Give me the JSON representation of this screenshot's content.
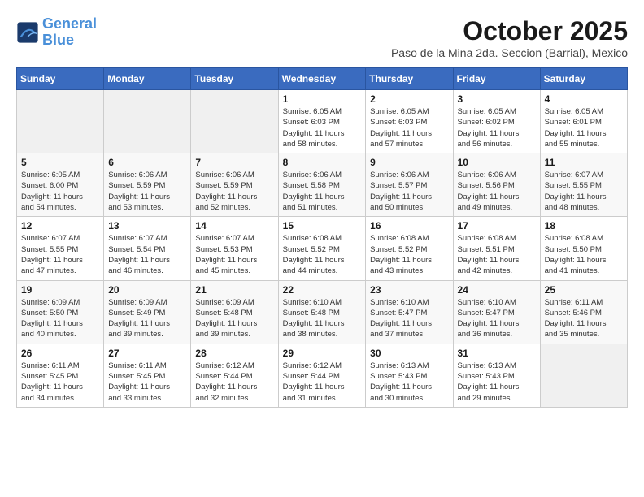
{
  "header": {
    "logo_line1": "General",
    "logo_line2": "Blue",
    "month": "October 2025",
    "location": "Paso de la Mina 2da. Seccion (Barrial), Mexico"
  },
  "days_of_week": [
    "Sunday",
    "Monday",
    "Tuesday",
    "Wednesday",
    "Thursday",
    "Friday",
    "Saturday"
  ],
  "weeks": [
    [
      {
        "num": "",
        "info": ""
      },
      {
        "num": "",
        "info": ""
      },
      {
        "num": "",
        "info": ""
      },
      {
        "num": "1",
        "info": "Sunrise: 6:05 AM\nSunset: 6:03 PM\nDaylight: 11 hours\nand 58 minutes."
      },
      {
        "num": "2",
        "info": "Sunrise: 6:05 AM\nSunset: 6:03 PM\nDaylight: 11 hours\nand 57 minutes."
      },
      {
        "num": "3",
        "info": "Sunrise: 6:05 AM\nSunset: 6:02 PM\nDaylight: 11 hours\nand 56 minutes."
      },
      {
        "num": "4",
        "info": "Sunrise: 6:05 AM\nSunset: 6:01 PM\nDaylight: 11 hours\nand 55 minutes."
      }
    ],
    [
      {
        "num": "5",
        "info": "Sunrise: 6:05 AM\nSunset: 6:00 PM\nDaylight: 11 hours\nand 54 minutes."
      },
      {
        "num": "6",
        "info": "Sunrise: 6:06 AM\nSunset: 5:59 PM\nDaylight: 11 hours\nand 53 minutes."
      },
      {
        "num": "7",
        "info": "Sunrise: 6:06 AM\nSunset: 5:59 PM\nDaylight: 11 hours\nand 52 minutes."
      },
      {
        "num": "8",
        "info": "Sunrise: 6:06 AM\nSunset: 5:58 PM\nDaylight: 11 hours\nand 51 minutes."
      },
      {
        "num": "9",
        "info": "Sunrise: 6:06 AM\nSunset: 5:57 PM\nDaylight: 11 hours\nand 50 minutes."
      },
      {
        "num": "10",
        "info": "Sunrise: 6:06 AM\nSunset: 5:56 PM\nDaylight: 11 hours\nand 49 minutes."
      },
      {
        "num": "11",
        "info": "Sunrise: 6:07 AM\nSunset: 5:55 PM\nDaylight: 11 hours\nand 48 minutes."
      }
    ],
    [
      {
        "num": "12",
        "info": "Sunrise: 6:07 AM\nSunset: 5:55 PM\nDaylight: 11 hours\nand 47 minutes."
      },
      {
        "num": "13",
        "info": "Sunrise: 6:07 AM\nSunset: 5:54 PM\nDaylight: 11 hours\nand 46 minutes."
      },
      {
        "num": "14",
        "info": "Sunrise: 6:07 AM\nSunset: 5:53 PM\nDaylight: 11 hours\nand 45 minutes."
      },
      {
        "num": "15",
        "info": "Sunrise: 6:08 AM\nSunset: 5:52 PM\nDaylight: 11 hours\nand 44 minutes."
      },
      {
        "num": "16",
        "info": "Sunrise: 6:08 AM\nSunset: 5:52 PM\nDaylight: 11 hours\nand 43 minutes."
      },
      {
        "num": "17",
        "info": "Sunrise: 6:08 AM\nSunset: 5:51 PM\nDaylight: 11 hours\nand 42 minutes."
      },
      {
        "num": "18",
        "info": "Sunrise: 6:08 AM\nSunset: 5:50 PM\nDaylight: 11 hours\nand 41 minutes."
      }
    ],
    [
      {
        "num": "19",
        "info": "Sunrise: 6:09 AM\nSunset: 5:50 PM\nDaylight: 11 hours\nand 40 minutes."
      },
      {
        "num": "20",
        "info": "Sunrise: 6:09 AM\nSunset: 5:49 PM\nDaylight: 11 hours\nand 39 minutes."
      },
      {
        "num": "21",
        "info": "Sunrise: 6:09 AM\nSunset: 5:48 PM\nDaylight: 11 hours\nand 39 minutes."
      },
      {
        "num": "22",
        "info": "Sunrise: 6:10 AM\nSunset: 5:48 PM\nDaylight: 11 hours\nand 38 minutes."
      },
      {
        "num": "23",
        "info": "Sunrise: 6:10 AM\nSunset: 5:47 PM\nDaylight: 11 hours\nand 37 minutes."
      },
      {
        "num": "24",
        "info": "Sunrise: 6:10 AM\nSunset: 5:47 PM\nDaylight: 11 hours\nand 36 minutes."
      },
      {
        "num": "25",
        "info": "Sunrise: 6:11 AM\nSunset: 5:46 PM\nDaylight: 11 hours\nand 35 minutes."
      }
    ],
    [
      {
        "num": "26",
        "info": "Sunrise: 6:11 AM\nSunset: 5:45 PM\nDaylight: 11 hours\nand 34 minutes."
      },
      {
        "num": "27",
        "info": "Sunrise: 6:11 AM\nSunset: 5:45 PM\nDaylight: 11 hours\nand 33 minutes."
      },
      {
        "num": "28",
        "info": "Sunrise: 6:12 AM\nSunset: 5:44 PM\nDaylight: 11 hours\nand 32 minutes."
      },
      {
        "num": "29",
        "info": "Sunrise: 6:12 AM\nSunset: 5:44 PM\nDaylight: 11 hours\nand 31 minutes."
      },
      {
        "num": "30",
        "info": "Sunrise: 6:13 AM\nSunset: 5:43 PM\nDaylight: 11 hours\nand 30 minutes."
      },
      {
        "num": "31",
        "info": "Sunrise: 6:13 AM\nSunset: 5:43 PM\nDaylight: 11 hours\nand 29 minutes."
      },
      {
        "num": "",
        "info": ""
      }
    ]
  ]
}
